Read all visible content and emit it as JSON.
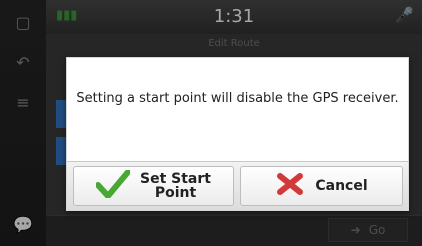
{
  "status": {
    "time": "1:31"
  },
  "content": {
    "section_title": "Edit Route"
  },
  "bottom": {
    "go_label": "Go"
  },
  "dialog": {
    "message": "Setting a start point will disable the GPS receiver.",
    "set_start_line1": "Set Start",
    "set_start_line2": "Point",
    "cancel_label": "Cancel"
  },
  "colors": {
    "accent_blue": "#3277c8",
    "check_green": "#47a832",
    "cancel_red": "#d23a3a"
  },
  "icons": {
    "rail_top": "window-icon",
    "rail_back": "back-icon",
    "rail_menu": "menu-icon",
    "rail_bottom": "speech-icon",
    "status_left": "gps-signal-icon",
    "status_right": "microphone-icon",
    "set_start": "checkmark-icon",
    "cancel": "x-icon",
    "go": "arrow-right-icon"
  }
}
